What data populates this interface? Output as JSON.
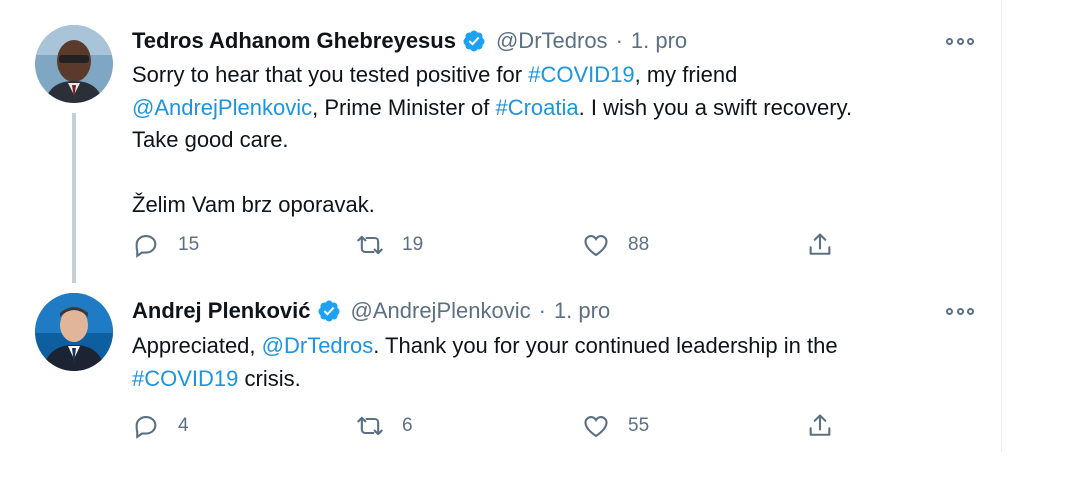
{
  "tweets": [
    {
      "display_name": "Tedros Adhanom Ghebreyesus",
      "handle": "@DrTedros",
      "separator": "·",
      "date": "1. pro",
      "body": {
        "l1_a": "Sorry to hear that you tested positive for ",
        "l1_tag": "#COVID19",
        "l1_b": ", my friend",
        "l2_mention": "@AndrejPlenkovic",
        "l2_a": ", Prime Minister of ",
        "l2_tag": "#Croatia",
        "l2_b": ". I wish you a swift recovery.",
        "l3": "Take good care.",
        "l4": "Želim Vam brz oporavak."
      },
      "replies": "15",
      "retweets": "19",
      "likes": "88"
    },
    {
      "display_name": "Andrej Plenković",
      "handle": "@AndrejPlenkovic",
      "separator": "·",
      "date": "1. pro",
      "body": {
        "l1_a": "Appreciated, ",
        "l1_mention": "@DrTedros",
        "l1_b": ". Thank you for your continued leadership in the",
        "l2_tag": "#COVID19",
        "l2_a": " crisis."
      },
      "replies": "4",
      "retweets": "6",
      "likes": "55"
    }
  ],
  "icons": {
    "verified": "verified-badge-icon",
    "more": "more-options-icon",
    "reply": "reply-icon",
    "retweet": "retweet-icon",
    "like": "heart-icon",
    "share": "share-icon"
  },
  "colors": {
    "link": "#1b95e0",
    "secondary_text": "#5b7083",
    "verified": "#1da1f2",
    "thread_line": "#c4cfd6"
  }
}
